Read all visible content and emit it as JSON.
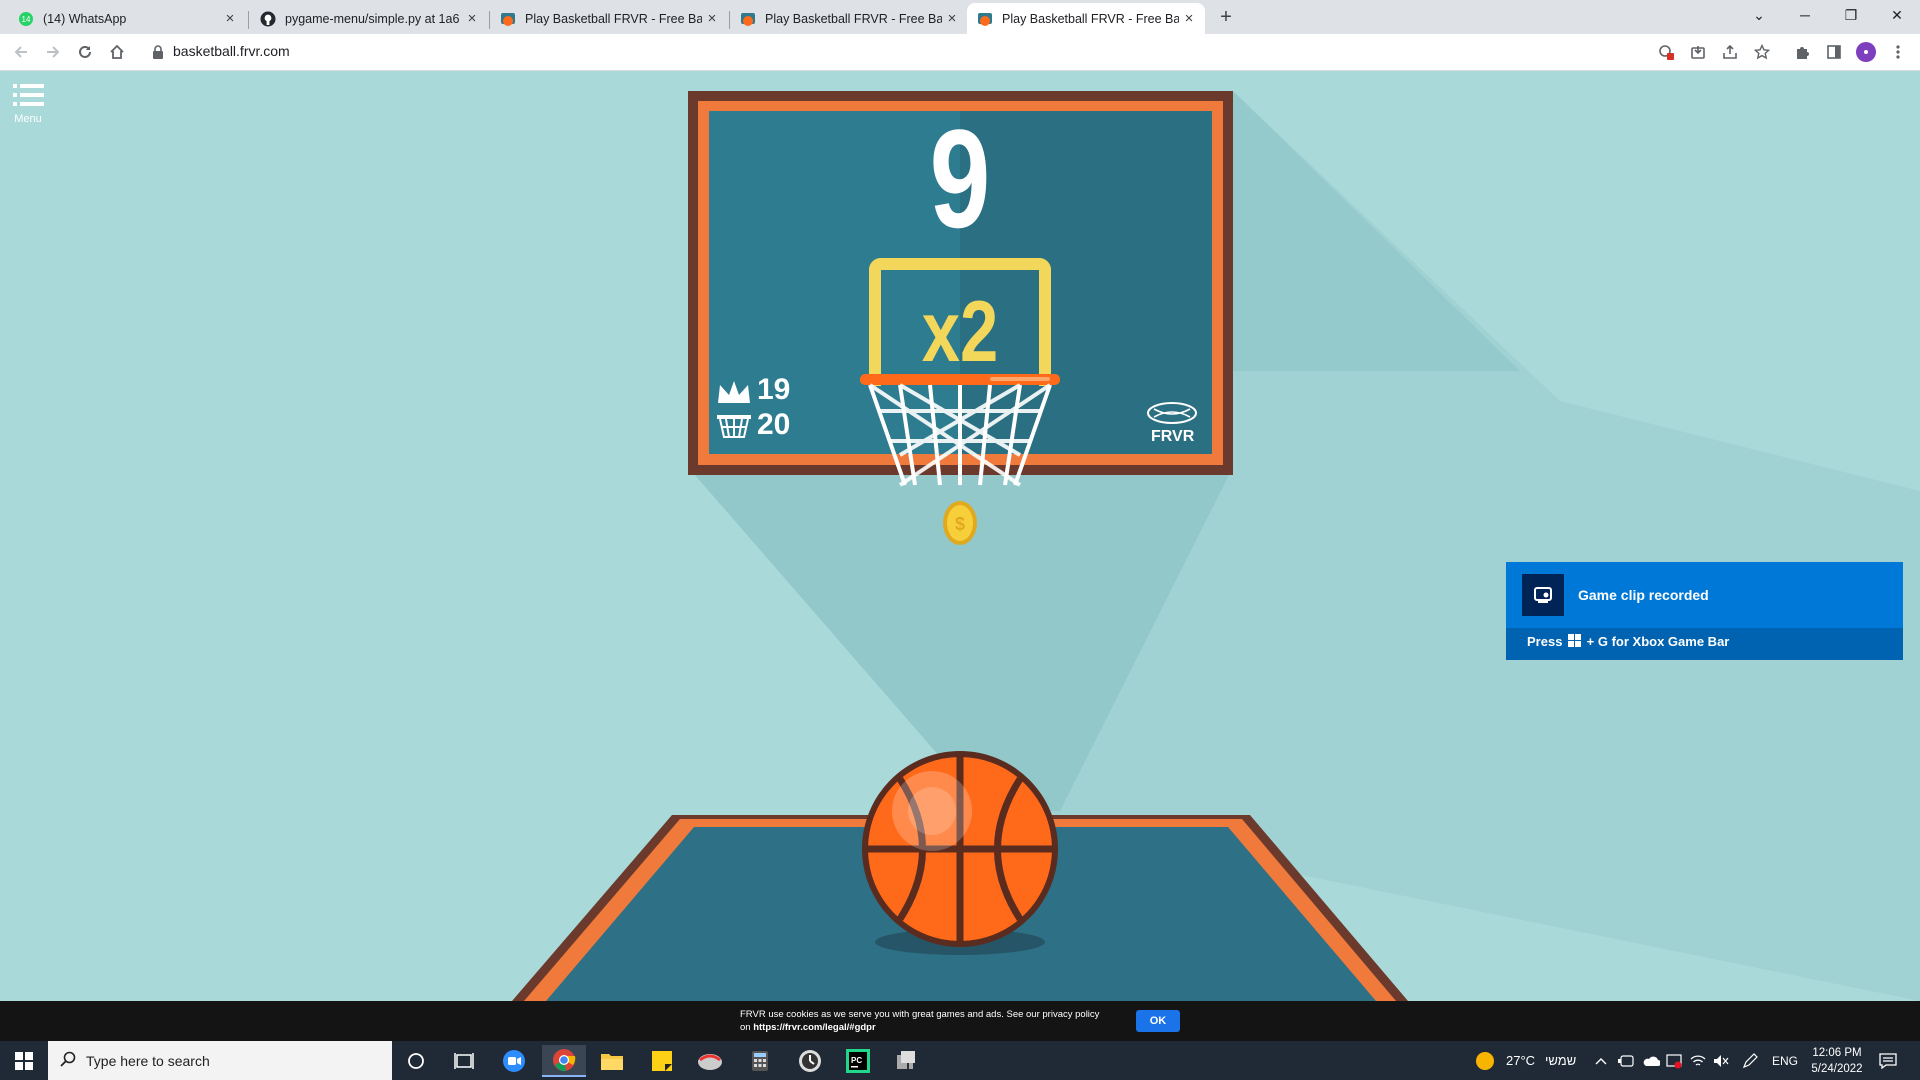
{
  "browser": {
    "tabs": [
      {
        "title": "(14) WhatsApp",
        "icon": "whatsapp-icon",
        "active": false
      },
      {
        "title": "pygame-menu/simple.py at 1a6",
        "icon": "github-icon",
        "active": false
      },
      {
        "title": "Play Basketball FRVR - Free Bask",
        "icon": "basketball-icon",
        "active": false
      },
      {
        "title": "Play Basketball FRVR - Free Bask",
        "icon": "basketball-icon",
        "active": false
      },
      {
        "title": "Play Basketball FRVR - Free Bask",
        "icon": "basketball-icon",
        "active": true
      }
    ],
    "new_tab": "+",
    "url": "basketball.frvr.com",
    "window_controls": {
      "tab_search": "⌄",
      "minimize": "─",
      "restore": "❐",
      "close": "✕"
    }
  },
  "game": {
    "menu_label": "Menu",
    "score": "9",
    "multiplier": "x2",
    "best_score": "19",
    "balls_count": "20",
    "brand": "FRVR",
    "colors": {
      "background": "#a9d9d9",
      "backboard": "#2f7a8c",
      "frame": "#f07a3b",
      "ball": "#ff6a1a",
      "multiplier": "#f3d75a"
    }
  },
  "toast": {
    "title": "Game clip recorded",
    "hint_prefix": "Press",
    "hint_suffix": "+ G for Xbox Game Bar"
  },
  "cookie": {
    "line1": "FRVR use cookies as we serve you with great games and ads. See our privacy policy",
    "line2_prefix": "on",
    "link": "https://frvr.com/legal/#gdpr",
    "ok": "OK"
  },
  "taskbar": {
    "search_placeholder": "Type here to search",
    "weather": "27°C",
    "weather_label": "שמשי",
    "language": "ENG",
    "time": "12:06 PM",
    "date": "5/24/2022"
  }
}
